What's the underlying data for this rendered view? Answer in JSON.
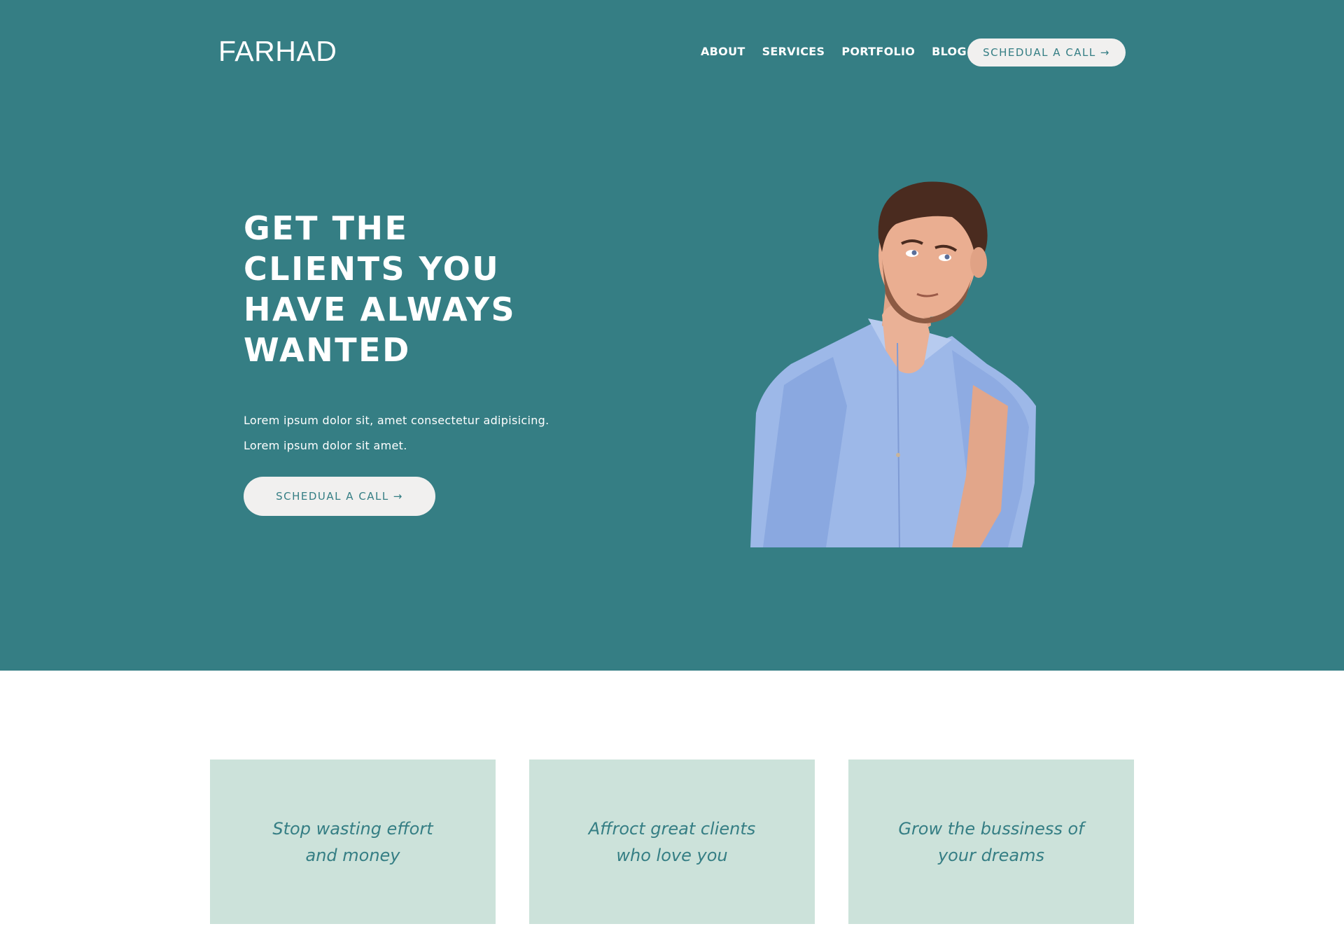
{
  "header": {
    "logo": "FARHAD",
    "nav": [
      "ABOUT",
      "SERVICES",
      "PORTFOLIO",
      "BLOG"
    ],
    "cta_label": "SCHEDUAL A CALL",
    "cta_arrow": "→"
  },
  "hero": {
    "headline_lines": [
      "GET THE",
      "CLIENTS YOU",
      "HAVE ALWAYS",
      "WANTED"
    ],
    "sub_lines": [
      "Lorem ipsum dolor sit, amet consectetur adipisicing.",
      "Lorem ipsum dolor sit amet."
    ],
    "cta_label": "SCHEDUAL A CALL",
    "cta_arrow": "→"
  },
  "cards": [
    {
      "lines": [
        "Stop wasting effort",
        "and money"
      ]
    },
    {
      "lines": [
        "Affroct great clients",
        "who love you"
      ]
    },
    {
      "lines": [
        "Grow the bussiness of",
        "your dreams"
      ]
    }
  ],
  "colors": {
    "hero_bg": "#357e84",
    "button_bg": "#f1f0ef",
    "card_bg": "#cce2da",
    "accent_text": "#357e84"
  }
}
